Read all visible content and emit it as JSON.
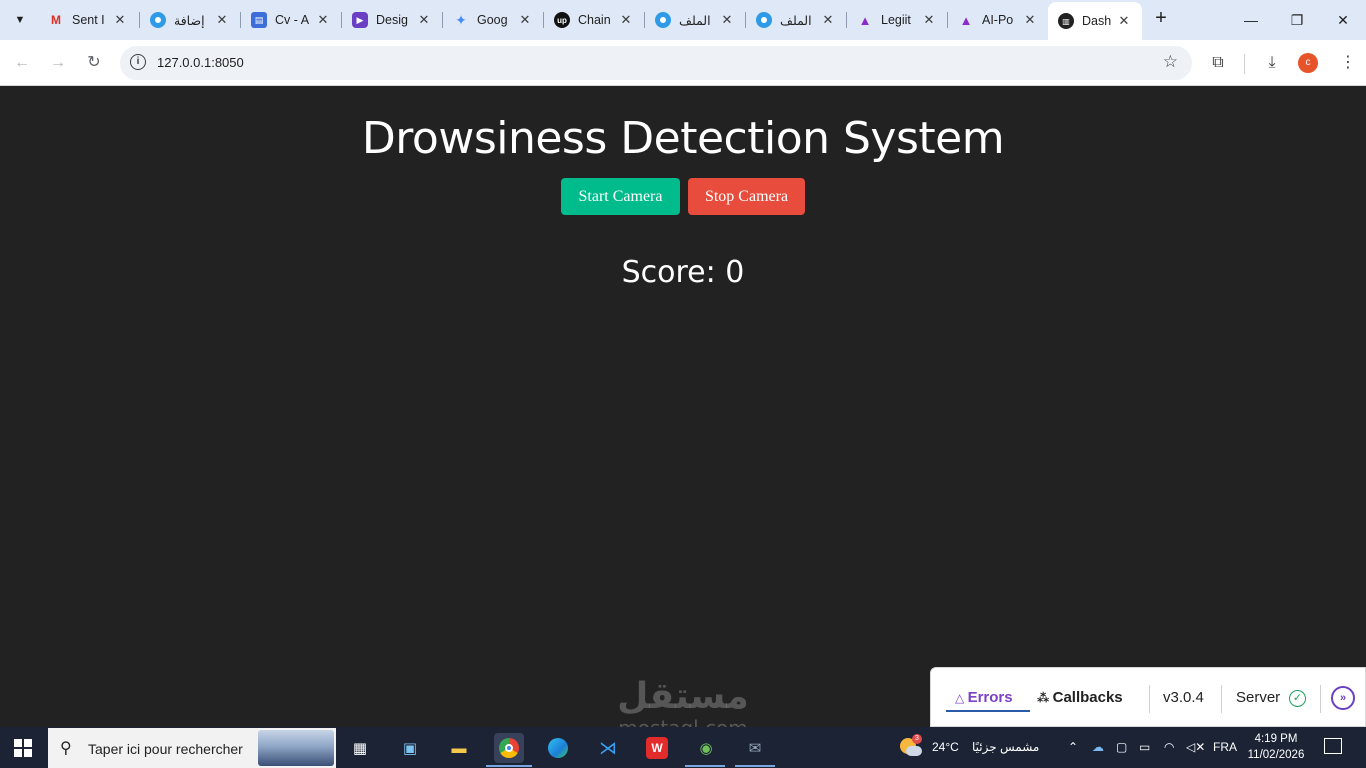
{
  "browser": {
    "tabs": [
      {
        "title": "Sent I",
        "icon": "gmail-icon",
        "color": "#d93025"
      },
      {
        "title": "إضافة",
        "icon": "circle-icon",
        "color": "#2f9be6"
      },
      {
        "title": "Cv - A",
        "icon": "printer-icon",
        "color": "#3b6ed8"
      },
      {
        "title": "Desig",
        "icon": "video-icon",
        "color": "#6a3fc4"
      },
      {
        "title": "Goog",
        "icon": "gemini-icon",
        "color": "#4b8bf5"
      },
      {
        "title": "Chain",
        "icon": "upwork-icon",
        "color": "#111111"
      },
      {
        "title": "الملف",
        "icon": "circle-icon",
        "color": "#2f9be6"
      },
      {
        "title": "الملف",
        "icon": "circle-icon",
        "color": "#2f9be6"
      },
      {
        "title": "Legiit",
        "icon": "m-logo-icon",
        "color": "#8a2cc9"
      },
      {
        "title": "AI-Po",
        "icon": "m-logo-icon",
        "color": "#8a2cc9"
      },
      {
        "title": "Dash",
        "icon": "dash-icon",
        "color": "#222222"
      }
    ],
    "active_tab_index": 10,
    "url": "127.0.0.1:8050",
    "profile_initial": "c"
  },
  "app": {
    "title": "Drowsiness Detection System",
    "start_label": "Start Camera",
    "stop_label": "Stop Camera",
    "score_label": "Score: 0",
    "colors": {
      "start": "#00bc8c",
      "stop": "#e74c3c",
      "background": "#222222"
    }
  },
  "devtools": {
    "errors_label": "Errors",
    "callbacks_label": "Callbacks",
    "version": "v3.0.4",
    "server_label": "Server"
  },
  "watermark": {
    "arabic": "مستقل",
    "latin": "mostaql.com"
  },
  "taskbar": {
    "search_placeholder": "Taper ici pour rechercher",
    "weather_temp": "24°C",
    "weather_text": "مشمس جزئيًا",
    "weather_badge": "3",
    "language": "FRA",
    "time": "4:19 PM",
    "date": "11/02/2026"
  }
}
